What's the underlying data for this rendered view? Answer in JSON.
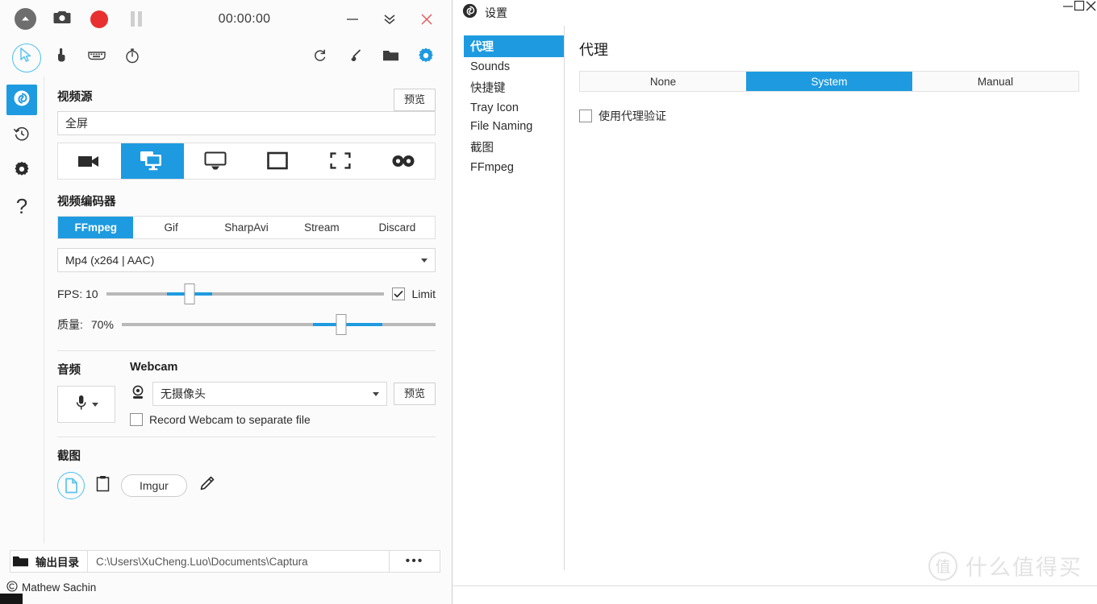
{
  "capturaWindow": {
    "titlebar": {
      "timer": "00:00:00",
      "buttons": {
        "expand": "expand-collapse",
        "screenshot": "screenshot",
        "record": "record",
        "pause": "pause",
        "minimize": "minimize",
        "collapse": "collapse",
        "close": "close"
      }
    },
    "toolbar": {
      "cursor": "cursor",
      "clicks": "mouse-clicks",
      "keystrokes": "keystrokes",
      "timer": "timer",
      "refresh": "refresh",
      "brush": "brush",
      "folder": "folder",
      "settings": "settings"
    },
    "rail": [
      {
        "name": "home",
        "label": "Home",
        "active": true
      },
      {
        "name": "history",
        "label": "History",
        "active": false
      },
      {
        "name": "settings",
        "label": "Settings",
        "active": false
      },
      {
        "name": "help",
        "label": "?",
        "active": false
      }
    ],
    "videoSource": {
      "title": "视频源",
      "previewButton": "预览",
      "value": "全屏",
      "modes": [
        {
          "name": "video-camera",
          "selected": false
        },
        {
          "name": "screens",
          "selected": true
        },
        {
          "name": "desktop",
          "selected": false
        },
        {
          "name": "window",
          "selected": false
        },
        {
          "name": "region",
          "selected": false
        },
        {
          "name": "no-video",
          "selected": false
        }
      ]
    },
    "videoEncoder": {
      "title": "视频编码器",
      "tabs": [
        {
          "label": "FFmpeg",
          "selected": true
        },
        {
          "label": "Gif",
          "selected": false
        },
        {
          "label": "SharpAvi",
          "selected": false
        },
        {
          "label": "Stream",
          "selected": false
        },
        {
          "label": "Discard",
          "selected": false
        }
      ],
      "format": "Mp4 (x264 | AAC)",
      "fps": {
        "label": "FPS: 10",
        "value": 10,
        "percent": 30
      },
      "limit": {
        "label": "Limit",
        "checked": true
      },
      "quality": {
        "label": "质量:",
        "value": "70%",
        "percent": 70
      }
    },
    "audio": {
      "title": "音频",
      "deviceIcon": "microphone"
    },
    "webcam": {
      "title": "Webcam",
      "value": "无摄像头",
      "previewButton": "预览",
      "recordSeparate": {
        "label": "Record Webcam to separate file",
        "checked": false
      }
    },
    "screenshotSection": {
      "title": "截图",
      "targets": [
        {
          "name": "save-to-file",
          "selected": true
        },
        {
          "name": "clipboard",
          "selected": false
        },
        {
          "name": "imgur",
          "label": "Imgur",
          "selected": false
        },
        {
          "name": "edit",
          "selected": false
        }
      ]
    },
    "footer": {
      "outputLabel": "输出目录",
      "outputPath": "C:\\Users\\XuCheng.Luo\\Documents\\Captura",
      "moreButton": "•••",
      "copyright": "Mathew Sachin"
    }
  },
  "settingsWindow": {
    "title": "设置",
    "windowControls": {
      "minimize": "minimize",
      "maximize": "maximize",
      "close": "close"
    },
    "nav": [
      {
        "label": "代理",
        "selected": true
      },
      {
        "label": "Sounds",
        "selected": false
      },
      {
        "label": "快捷键",
        "selected": false
      },
      {
        "label": "Tray Icon",
        "selected": false
      },
      {
        "label": "File Naming",
        "selected": false
      },
      {
        "label": "截图",
        "selected": false
      },
      {
        "label": "FFmpeg",
        "selected": false
      }
    ],
    "heading": "代理",
    "proxyTabs": [
      {
        "label": "None",
        "selected": false
      },
      {
        "label": "System",
        "selected": true
      },
      {
        "label": "Manual",
        "selected": false
      }
    ],
    "useAuth": {
      "label": "使用代理验证",
      "checked": false
    }
  },
  "watermark": {
    "badge": "值",
    "text": "什么值得买"
  },
  "colors": {
    "accent": "#1e9be0",
    "record": "#e83030",
    "selectionRing": "#4fc0f0"
  }
}
